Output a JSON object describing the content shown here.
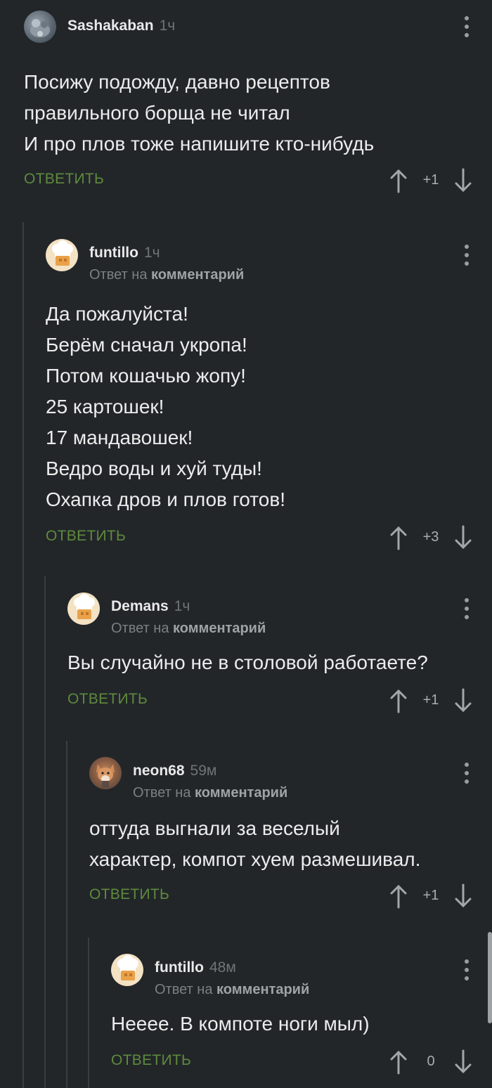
{
  "comments": [
    {
      "user": "Sashakaban",
      "time": "1ч",
      "reply_to": "",
      "body": "Посижу подожду, давно рецептов\nправильного борща не читал\nИ про плов тоже напишите кто-нибудь",
      "reply_label": "ОТВЕТИТЬ",
      "score": "+1"
    },
    {
      "user": "funtillo",
      "time": "1ч",
      "reply_to_prefix": "Ответ на",
      "reply_to": "комментарий",
      "body": "Да пожалуйста!\nБерём сначал укропа!\nПотом кошачью жопу!\n25 картошек!\n17 мандавошек!\nВедро воды и хуй туды!\nОхапка дров и плов готов!",
      "reply_label": "ОТВЕТИТЬ",
      "score": "+3"
    },
    {
      "user": "Demans",
      "time": "1ч",
      "reply_to_prefix": "Ответ на",
      "reply_to": "комментарий",
      "body": "Вы случайно не в столовой работаете?",
      "reply_label": "ОТВЕТИТЬ",
      "score": "+1"
    },
    {
      "user": "neon68",
      "time": "59м",
      "reply_to_prefix": "Ответ на",
      "reply_to": "комментарий",
      "body": "оттуда выгнали за веселый\nхарактер, компот хуем размешивал.",
      "reply_label": "ОТВЕТИТЬ",
      "score": "+1"
    },
    {
      "user": "funtillo",
      "time": "48м",
      "reply_to_prefix": "Ответ на",
      "reply_to": "комментарий",
      "body": "Неееe. В компоте ноги мыл)",
      "reply_label": "ОТВЕТИТЬ",
      "score": "0"
    }
  ],
  "icons": {
    "avatar_1": "user-photo-avatar",
    "avatar_cook": "chef-hat-avatar",
    "avatar_fox": "fox-photo-avatar",
    "menu": "more-vertical-icon",
    "upvote": "arrow-up-icon",
    "downvote": "arrow-down-icon"
  },
  "colors": {
    "background": "#222629",
    "reply_link": "#5f8a3d",
    "thread_line": "#3a3e42"
  }
}
